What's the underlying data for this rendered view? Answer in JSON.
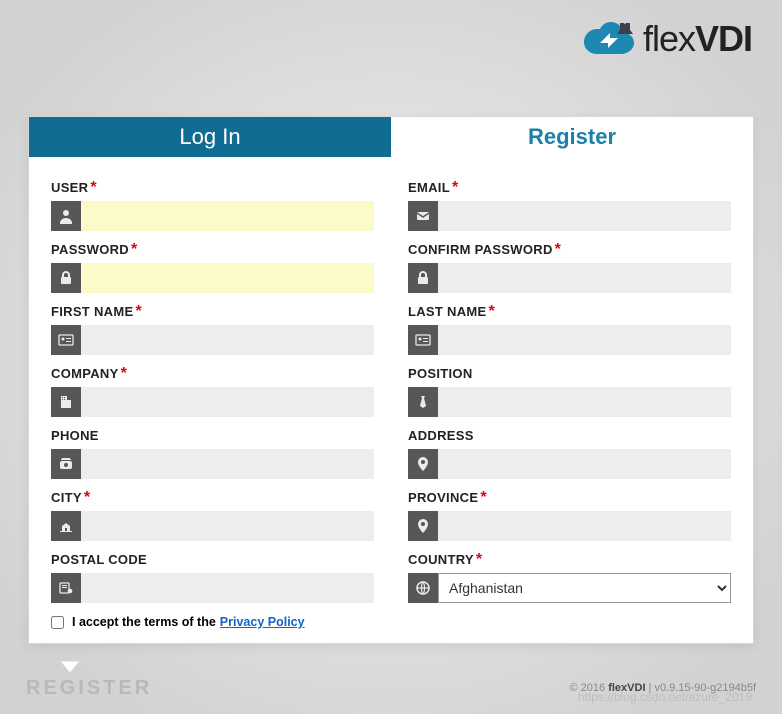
{
  "brand": {
    "name_light": "flex",
    "name_bold": "VDI"
  },
  "tabs": {
    "login": "Log In",
    "register": "Register"
  },
  "fields": {
    "user": {
      "label": "USER",
      "value": "",
      "required": true,
      "highlight": true
    },
    "email": {
      "label": "EMAIL",
      "value": "",
      "required": true
    },
    "password": {
      "label": "PASSWORD",
      "value": "",
      "required": true,
      "highlight": true
    },
    "confirm": {
      "label": "CONFIRM PASSWORD",
      "value": "",
      "required": true
    },
    "first": {
      "label": "FIRST NAME",
      "value": "",
      "required": true
    },
    "last": {
      "label": "LAST NAME",
      "value": "",
      "required": true
    },
    "company": {
      "label": "COMPANY",
      "value": "",
      "required": true
    },
    "position": {
      "label": "POSITION",
      "value": "",
      "required": false
    },
    "phone": {
      "label": "PHONE",
      "value": "",
      "required": false
    },
    "address": {
      "label": "ADDRESS",
      "value": "",
      "required": false
    },
    "city": {
      "label": "CITY",
      "value": "",
      "required": true
    },
    "province": {
      "label": "PROVINCE",
      "value": "",
      "required": true
    },
    "postal": {
      "label": "POSTAL CODE",
      "value": "",
      "required": false
    },
    "country": {
      "label": "COUNTRY",
      "value": "Afghanistan",
      "required": true
    }
  },
  "terms": {
    "prefix": "I accept the terms of the",
    "link": "Privacy Policy",
    "checked": false
  },
  "footer": {
    "heading": "REGISTER",
    "copyright_prefix": "© 2016 ",
    "copyright_brand": "flexVDI",
    "version": " | v0.9.15-90-g2194b5f"
  },
  "watermark": "https://blog.csdn.net/azure_2019"
}
